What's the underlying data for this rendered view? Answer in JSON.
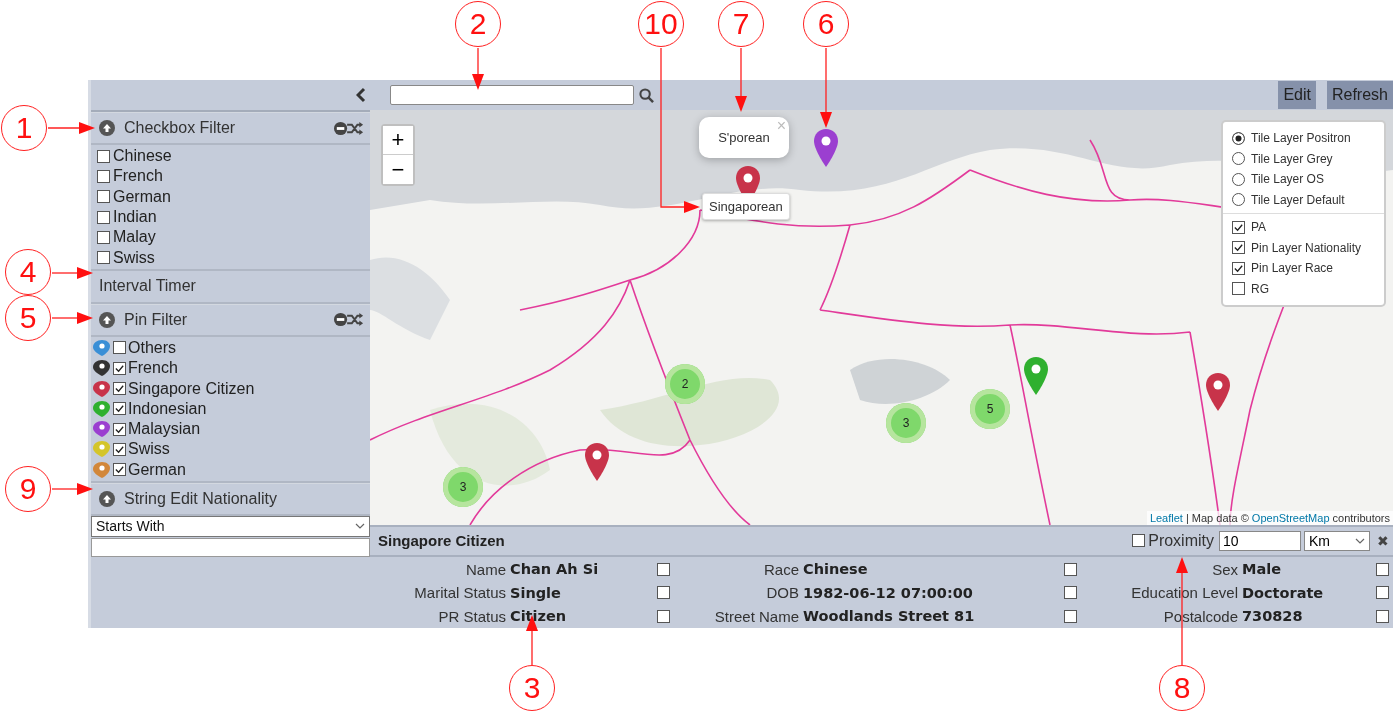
{
  "sidebar": {
    "checkbox_filter": {
      "title": "Checkbox Filter",
      "items": [
        {
          "label": "Chinese",
          "checked": false
        },
        {
          "label": "French",
          "checked": false
        },
        {
          "label": "German",
          "checked": false
        },
        {
          "label": "Indian",
          "checked": false
        },
        {
          "label": "Malay",
          "checked": false
        },
        {
          "label": "Swiss",
          "checked": false
        }
      ]
    },
    "interval_timer": {
      "title": "Interval Timer"
    },
    "pin_filter": {
      "title": "Pin Filter",
      "items": [
        {
          "label": "Others",
          "checked": false,
          "color": "#3a8fd6"
        },
        {
          "label": "French",
          "checked": true,
          "color": "#333333"
        },
        {
          "label": "Singapore Citizen",
          "checked": true,
          "color": "#c8334a"
        },
        {
          "label": "Indonesian",
          "checked": true,
          "color": "#2fb02f"
        },
        {
          "label": "Malaysian",
          "checked": true,
          "color": "#9b3fd0"
        },
        {
          "label": "Swiss",
          "checked": true,
          "color": "#d4c52a"
        },
        {
          "label": "German",
          "checked": true,
          "color": "#d2873a"
        }
      ]
    },
    "string_edit": {
      "title": "String Edit Nationality",
      "match_mode": "Starts With"
    }
  },
  "toolbar_buttons": [
    "Edit",
    "Refresh"
  ],
  "map": {
    "zoom_in": "+",
    "zoom_out": "−",
    "popup": {
      "text": "S'porean",
      "close": "×"
    },
    "tooltip": "Singaporean",
    "pins": [
      {
        "color": "#c8334a"
      },
      {
        "color": "#9b3fd0"
      },
      {
        "color": "#c8334a"
      },
      {
        "color": "#2fb02f"
      },
      {
        "color": "#c8334a"
      }
    ],
    "clusters": [
      {
        "count": "2"
      },
      {
        "count": "5"
      },
      {
        "count": "3"
      },
      {
        "count": "3"
      }
    ],
    "attribution": {
      "link": "Leaflet",
      "text": "| Map data ©",
      "source": "OpenStreetMap",
      "suffix": "contributors"
    }
  },
  "layer_control": {
    "base_layers": [
      {
        "label": "Tile Layer Positron",
        "selected": true
      },
      {
        "label": "Tile Layer Grey",
        "selected": false
      },
      {
        "label": "Tile Layer OS",
        "selected": false
      },
      {
        "label": "Tile Layer Default",
        "selected": false
      }
    ],
    "overlays": [
      {
        "label": "PA",
        "checked": true
      },
      {
        "label": "Pin Layer Nationality",
        "checked": true
      },
      {
        "label": "Pin Layer Race",
        "checked": true
      },
      {
        "label": "RG",
        "checked": false
      }
    ]
  },
  "details": {
    "title": "Singapore Citizen",
    "proximity": {
      "label": "Proximity",
      "checked": false,
      "distance": "10",
      "unit": "Km"
    },
    "close": "✖",
    "fields": [
      {
        "label": "Name",
        "value": "Chan Ah Si",
        "checked": false
      },
      {
        "label": "Race",
        "value": "Chinese",
        "checked": false
      },
      {
        "label": "Sex",
        "value": "Male",
        "checked": false
      },
      {
        "label": "Marital Status",
        "value": "Single",
        "checked": false
      },
      {
        "label": "DOB",
        "value": "1982-06-12 07:00:00",
        "checked": false
      },
      {
        "label": "Education Level",
        "value": "Doctorate",
        "checked": false
      },
      {
        "label": "PR Status",
        "value": "Citizen",
        "checked": false
      },
      {
        "label": "Street Name",
        "value": "Woodlands Street 81",
        "checked": false
      },
      {
        "label": "Postalcode",
        "value": "730828",
        "checked": false
      }
    ]
  },
  "callouts": [
    {
      "number": "2"
    },
    {
      "number": "10"
    },
    {
      "number": "7"
    },
    {
      "number": "6"
    },
    {
      "number": "1"
    },
    {
      "number": "4"
    },
    {
      "number": "5"
    },
    {
      "number": "9"
    },
    {
      "number": "3"
    },
    {
      "number": "8"
    }
  ]
}
